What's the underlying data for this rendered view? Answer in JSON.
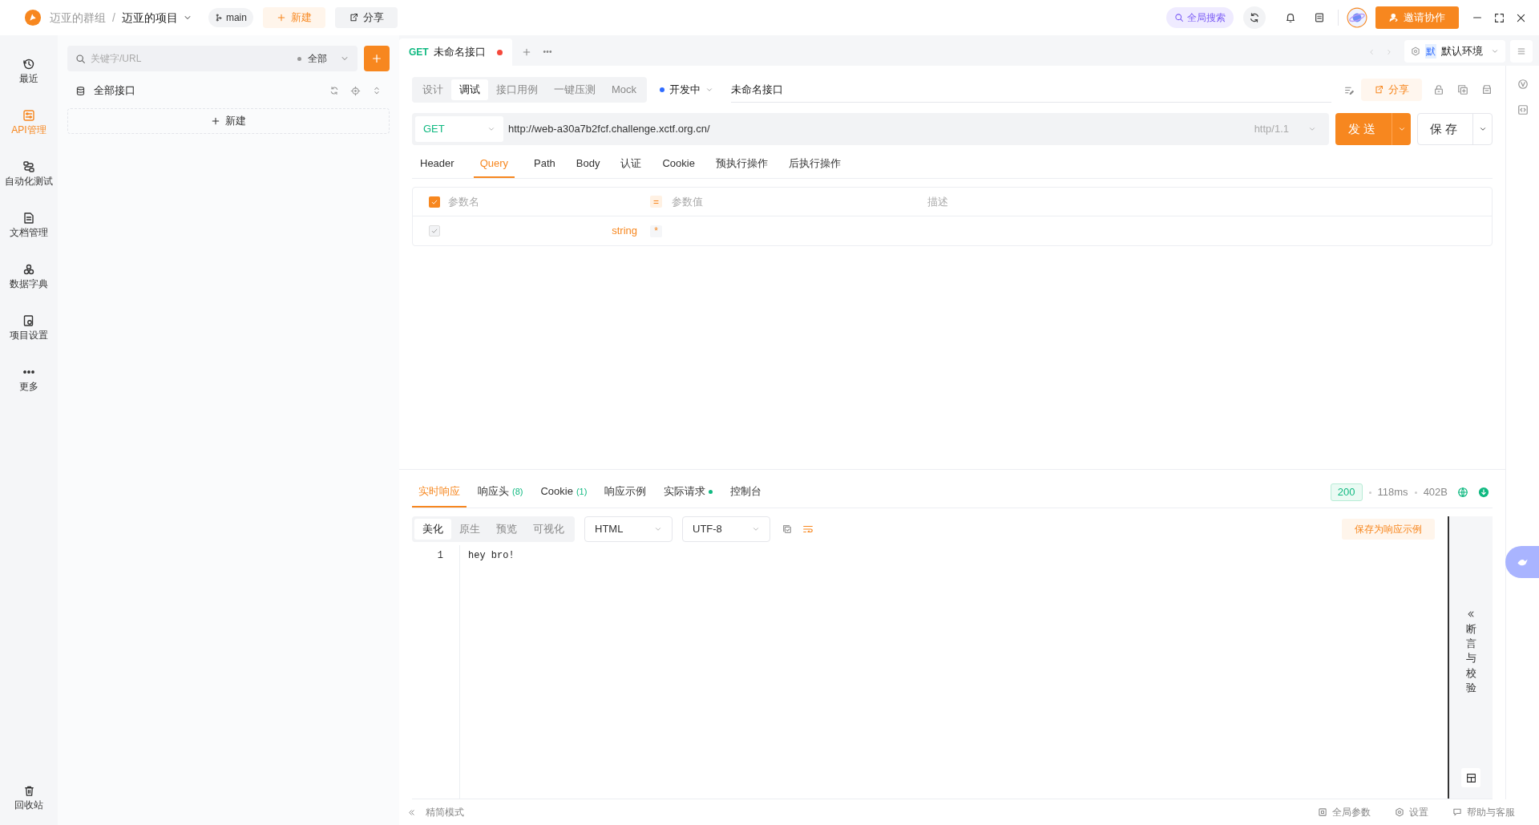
{
  "title_bar": {
    "group": "迈亚的群组",
    "separator": "/",
    "project": "迈亚的项目",
    "branch": "main",
    "new_button": "新建",
    "share_button": "分享",
    "global_search": "全局搜索",
    "invite_button": "邀请协作"
  },
  "nav_rail": {
    "items": [
      {
        "label": "最近",
        "selected": false
      },
      {
        "label": "API管理",
        "selected": true
      },
      {
        "label": "自动化测试",
        "selected": false
      },
      {
        "label": "文档管理",
        "selected": false
      },
      {
        "label": "数据字典",
        "selected": false
      },
      {
        "label": "项目设置",
        "selected": false
      },
      {
        "label": "更多",
        "selected": false
      }
    ],
    "trash": "回收站"
  },
  "api_tree": {
    "search_placeholder": "关键字/URL",
    "filter": "全部",
    "root": "全部接口",
    "new_button": "新建"
  },
  "tabs": [
    {
      "method": "GET",
      "label": "未命名接口",
      "selected": true,
      "unsaved": true
    }
  ],
  "environment": {
    "badge": "默",
    "name": "默认环境"
  },
  "mode_tabs": [
    {
      "label": "设计",
      "selected": false
    },
    {
      "label": "调试",
      "selected": true
    },
    {
      "label": "接口用例",
      "selected": false
    },
    {
      "label": "一键压测",
      "selected": false
    },
    {
      "label": "Mock",
      "selected": false
    }
  ],
  "api_status": "开发中",
  "api_name": "未命名接口",
  "share_button": "分享",
  "request": {
    "method": "GET",
    "url": "http://web-a30a7b2fcf.challenge.xctf.org.cn/",
    "protocol": "http/1.1",
    "send_button": "发送",
    "save_button": "保存"
  },
  "param_tabs": [
    {
      "label": "Header",
      "selected": false
    },
    {
      "label": "Query",
      "selected": true
    },
    {
      "label": "Path",
      "selected": false
    },
    {
      "label": "Body",
      "selected": false
    },
    {
      "label": "认证",
      "selected": false
    },
    {
      "label": "Cookie",
      "selected": false
    },
    {
      "label": "预执行操作",
      "selected": false
    },
    {
      "label": "后执行操作",
      "selected": false
    }
  ],
  "params_table": {
    "all_checked": true,
    "columns": [
      "参数名",
      "=",
      "参数值",
      "描述"
    ],
    "rows": [
      {
        "checked": true,
        "type": "string",
        "required_mark": "*"
      }
    ]
  },
  "response": {
    "tabs": [
      {
        "label": "实时响应",
        "selected": true
      },
      {
        "label": "响应头",
        "count": "(8)",
        "selected": false
      },
      {
        "label": "Cookie",
        "count": "(1)",
        "selected": false
      },
      {
        "label": "响应示例",
        "selected": false
      },
      {
        "label": "实际请求",
        "dot": true,
        "selected": false
      },
      {
        "label": "控制台",
        "selected": false
      }
    ],
    "status_code": "200",
    "time": "118ms",
    "size": "402B",
    "view_tabs": [
      {
        "label": "美化",
        "selected": true
      },
      {
        "label": "原生",
        "selected": false
      },
      {
        "label": "预览",
        "selected": false
      },
      {
        "label": "可视化",
        "selected": false
      }
    ],
    "format": "HTML",
    "encoding": "UTF-8",
    "save_example_button": "保存为响应示例",
    "lines": [
      {
        "number": "1",
        "text": "hey bro!"
      }
    ],
    "side_panel": "断言与校验"
  },
  "footer": {
    "compact_mode": "精简模式",
    "global_params": "全局参数",
    "settings": "设置",
    "help": "帮助与客服"
  }
}
